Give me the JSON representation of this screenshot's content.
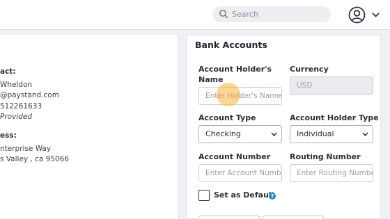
{
  "header": {
    "search_placeholder": "Search",
    "icons": {
      "search": "search-icon",
      "user": "user-account-icon",
      "menu": "chevron-down-icon"
    }
  },
  "left_panel": {
    "contact_label": "act:",
    "contact_name": "Wheldon",
    "contact_email": "@paystand.com",
    "contact_phone": "512261633",
    "contact_note": "Provided",
    "address_label": "ess:",
    "address_line1": "nterprise Way",
    "address_line2": "s Valley , ca 95066"
  },
  "bank": {
    "title": "Bank Accounts",
    "holder_name_label": "Account Holder's Name",
    "holder_name_placeholder": "Enter Holder's Name",
    "currency_label": "Currency",
    "currency_value": "USD",
    "account_type_label": "Account Type",
    "account_type_value": "Checking",
    "holder_type_label": "Account Holder Type",
    "holder_type_value": "Individual",
    "account_number_label": "Account Number",
    "account_number_placeholder": "Enter Account Number",
    "routing_number_label": "Routing Number",
    "routing_number_placeholder": "Enter Routing Number",
    "default_label": "Set as Default",
    "help_icon": "help-icon"
  },
  "colors": {
    "accent": "#1f8ad1",
    "click_highlight": "#f5b23c"
  }
}
